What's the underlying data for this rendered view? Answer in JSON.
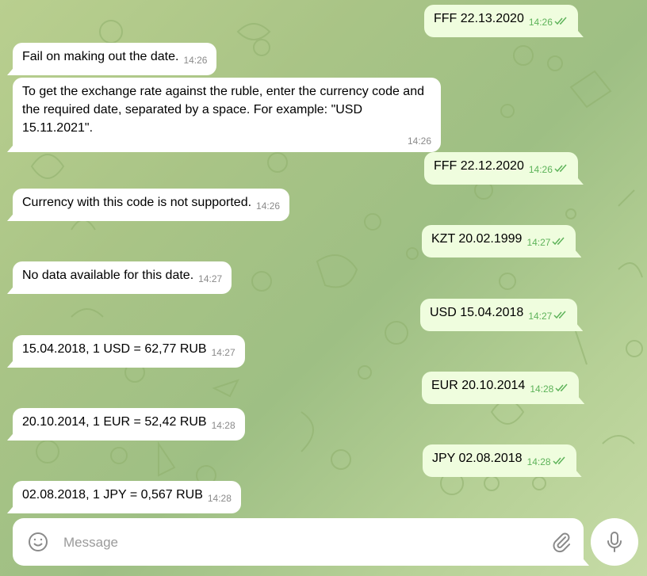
{
  "chat": {
    "messages": [
      {
        "side": "out",
        "text": "FFF 22.13.2020",
        "time": "14:26"
      },
      {
        "side": "in",
        "text": "Fail on making out the date.",
        "time": "14:26"
      },
      {
        "side": "in",
        "text": "To get the exchange rate against the ruble, enter the currency code and the required date, separated by a space. For example: \"USD 15.11.2021\".",
        "time": "14:26"
      },
      {
        "side": "out",
        "text": "FFF 22.12.2020",
        "time": "14:26"
      },
      {
        "side": "in",
        "text": "Currency with this code is not supported.",
        "time": "14:26"
      },
      {
        "side": "out",
        "text": "KZT 20.02.1999",
        "time": "14:27"
      },
      {
        "side": "in",
        "text": "No data available for this date.",
        "time": "14:27"
      },
      {
        "side": "out",
        "text": "USD 15.04.2018",
        "time": "14:27"
      },
      {
        "side": "in",
        "text": "15.04.2018, 1 USD =  62,77 RUB",
        "time": "14:27"
      },
      {
        "side": "out",
        "text": "EUR 20.10.2014",
        "time": "14:28"
      },
      {
        "side": "in",
        "text": "20.10.2014, 1 EUR =  52,42 RUB",
        "time": "14:28"
      },
      {
        "side": "out",
        "text": "JPY 02.08.2018",
        "time": "14:28"
      },
      {
        "side": "in",
        "text": "02.08.2018, 1 JPY =  0,567 RUB",
        "time": "14:28"
      }
    ]
  },
  "composer": {
    "placeholder": "Message",
    "value": "",
    "icons": {
      "emoji": "smile-icon",
      "attach": "paperclip-icon",
      "send": "microphone-icon"
    }
  },
  "colors": {
    "incoming_bubble": "#ffffff",
    "outgoing_bubble": "#effdde",
    "outgoing_time": "#5eb35a",
    "background": "#a9c486"
  }
}
